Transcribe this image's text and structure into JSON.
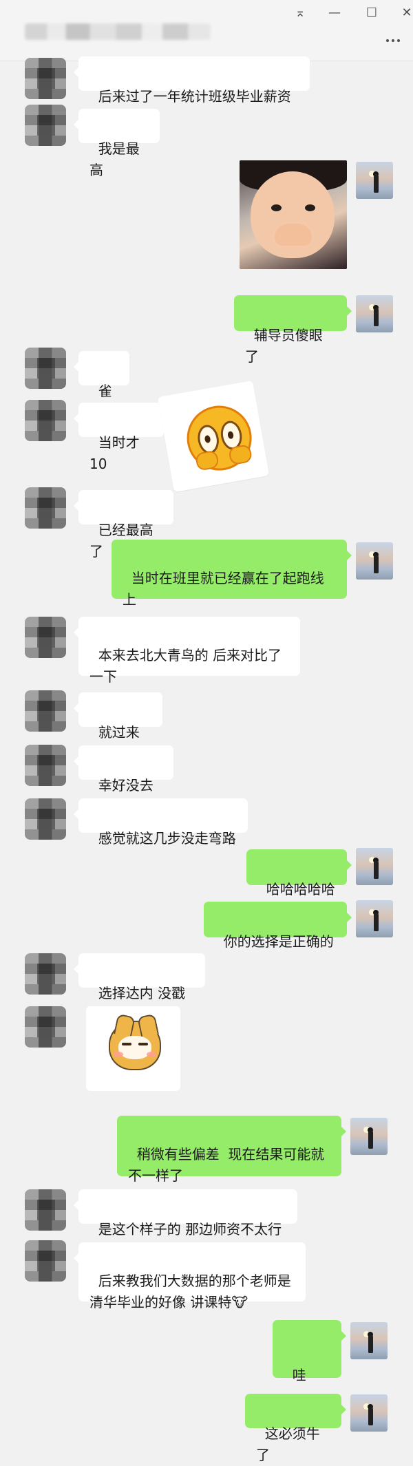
{
  "window": {
    "pin": "⌅",
    "minimize": "—",
    "maximize": "☐",
    "close": "✕",
    "more": "···"
  },
  "messages": {
    "m1": "后来过了一年统计班级毕业薪资",
    "m2": "我是最高",
    "m3": "辅导员傻眼了",
    "m4": "雀实",
    "m5": "当时才10",
    "m6": "已经最高了",
    "m7": "当时在班里就已经赢在了起跑线\n上",
    "m8": "本来去北大青鸟的 后来对比了\n一下",
    "m9": "就过来了",
    "m10": "幸好没去",
    "m11": "感觉就这几步没走弯路",
    "m12": "哈哈哈哈哈",
    "m13": "你的选择是正确的",
    "m14": "选择达内 没戳的",
    "m15": "稍微有些偏差  现在结果可能就\n不一样了",
    "m16": "是这个样子的 那边师资不太行",
    "m17": "后来教我们大数据的那个老师是\n清华毕业的好像 讲课特🐮",
    "m18": "哇~~~",
    "m19": "这必须牛了"
  },
  "icons": {
    "photo": "child-covering-mouth-photo",
    "sticker1": "shocked-emoji-sticker",
    "sticker2": "smirking-shiba-sticker"
  },
  "colors": {
    "background": "#f1f1f1",
    "incoming": "#ffffff",
    "outgoing": "#95ec69"
  }
}
